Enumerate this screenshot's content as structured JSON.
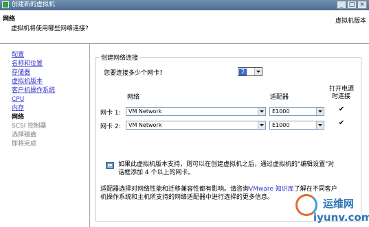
{
  "window": {
    "title": "创建新的虚拟机",
    "min": "_",
    "max": "□",
    "close": "×"
  },
  "header": {
    "title": "网络",
    "subtitle": "虚拟机将使用哪些网络连接?",
    "right_label": "虚拟机版本"
  },
  "sidebar": {
    "items": [
      {
        "label": "配置",
        "state": "link"
      },
      {
        "label": "名称和位置",
        "state": "link"
      },
      {
        "label": "存储器",
        "state": "link"
      },
      {
        "label": "虚拟机版本",
        "state": "link"
      },
      {
        "label": "客户机操作系统",
        "state": "link"
      },
      {
        "label": "CPU",
        "state": "link"
      },
      {
        "label": "内存",
        "state": "link"
      },
      {
        "label": "网络",
        "state": "current"
      },
      {
        "label": "SCSI 控制器",
        "state": "future"
      },
      {
        "label": "选择磁盘",
        "state": "future"
      },
      {
        "label": "即将完成",
        "state": "future"
      }
    ]
  },
  "main": {
    "group_title": "创建网络连接",
    "nic_count_label": "您要连接多少个网卡?",
    "nic_count_value": "2",
    "columns": {
      "network": "网络",
      "adapter": "适配器",
      "power_on_line1": "打开电源",
      "power_on_line2": "时连接"
    },
    "nics": [
      {
        "label": "网卡 1:",
        "network": "VM Network",
        "adapter": "E1000",
        "connect": "✔"
      },
      {
        "label": "网卡 2:",
        "network": "VM Network",
        "adapter": "E1000",
        "connect": "✔"
      }
    ],
    "info_line1": "如果此虚拟机版本支持，则可以在创建虚拟机之后，通过虚拟机的\"编辑设置\"对",
    "info_line2": "话框添加 4 个以上的网卡。",
    "help_line1_a": "适配器选择对网络性能和迁移兼容性都有影响。请咨询",
    "help_link": "VMware 知识库",
    "help_line1_b": "了解在不同客户",
    "help_line2": "机操作系统和主机所支持的网络适配器中进行选择的更多信息。"
  },
  "watermark": {
    "cn": "运维网",
    "en": "iyunv.com"
  },
  "colors": {
    "link": "#3333cc",
    "titlebar": "#5a7ba0",
    "selection": "#316ac5"
  }
}
